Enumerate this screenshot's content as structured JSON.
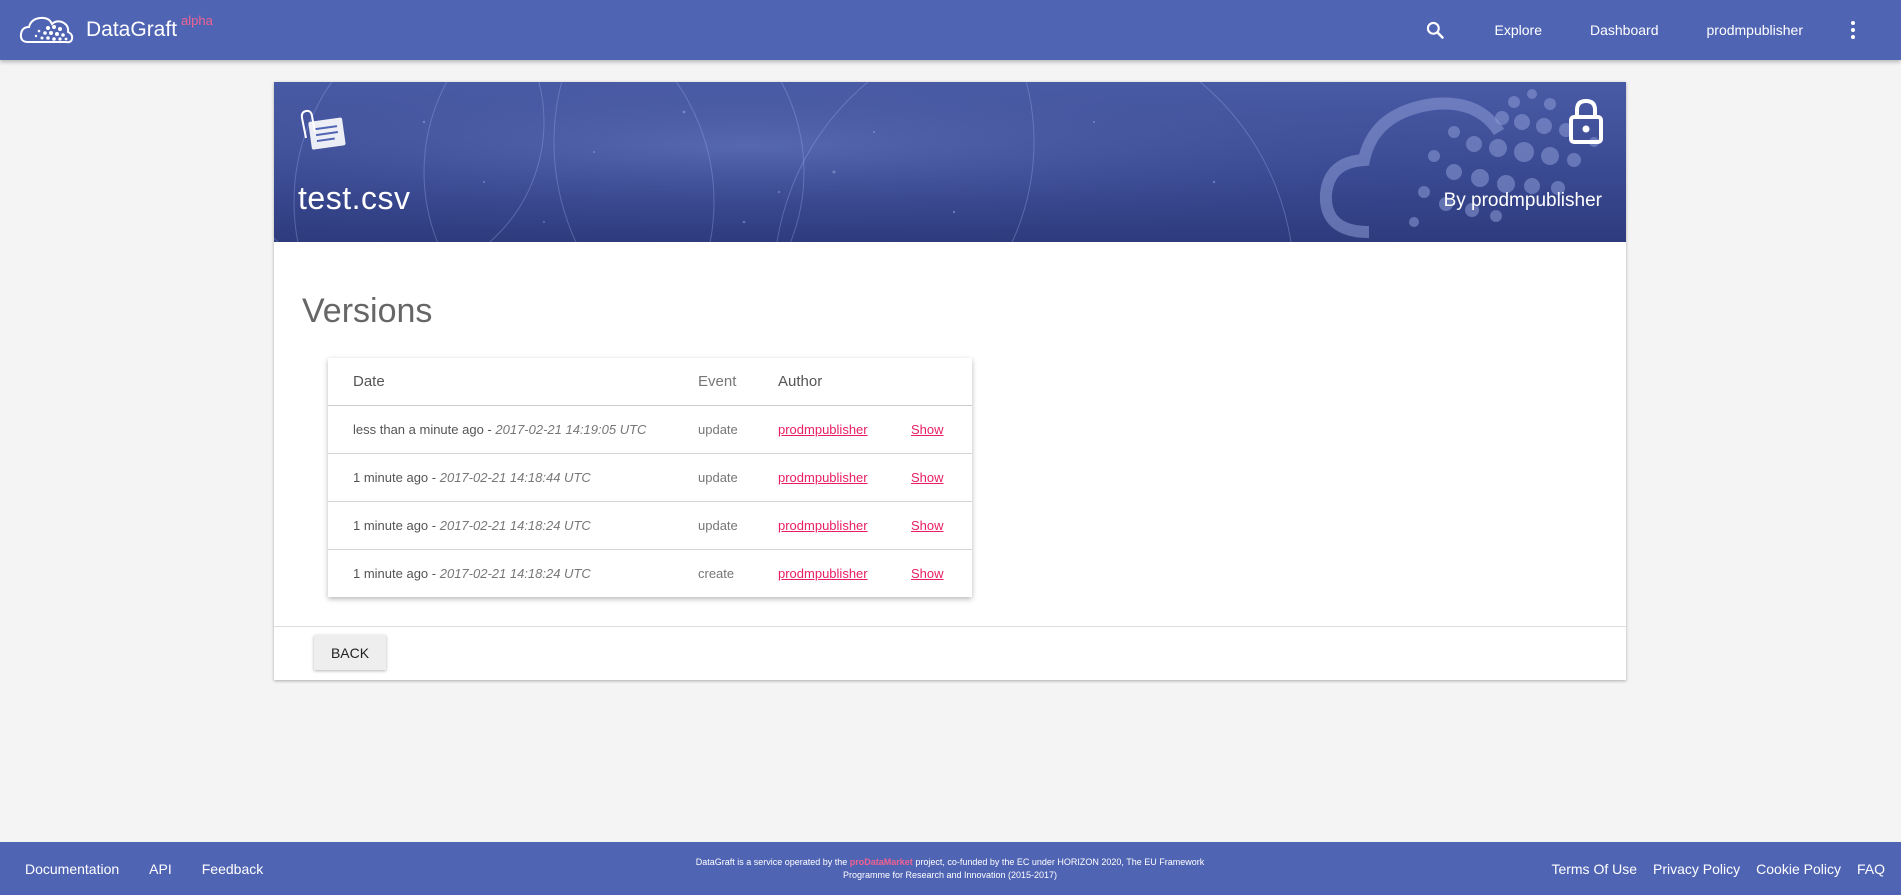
{
  "nav": {
    "brand": "DataGraft",
    "brand_tag": "alpha",
    "links": [
      "Explore",
      "Dashboard",
      "prodmpublisher"
    ]
  },
  "banner": {
    "title": "test.csv",
    "by": "By prodmpublisher"
  },
  "versions": {
    "title": "Versions",
    "columns": [
      "Date",
      "Event",
      "Author",
      ""
    ],
    "rows": [
      {
        "relative": "less than a minute ago",
        "timestamp": "2017-02-21 14:19:05 UTC",
        "event": "update",
        "author": "prodmpublisher",
        "action": "Show"
      },
      {
        "relative": "1 minute ago",
        "timestamp": "2017-02-21 14:18:44 UTC",
        "event": "update",
        "author": "prodmpublisher",
        "action": "Show"
      },
      {
        "relative": "1 minute ago",
        "timestamp": "2017-02-21 14:18:24 UTC",
        "event": "update",
        "author": "prodmpublisher",
        "action": "Show"
      },
      {
        "relative": "1 minute ago",
        "timestamp": "2017-02-21 14:18:24 UTC",
        "event": "create",
        "author": "prodmpublisher",
        "action": "Show"
      }
    ],
    "separator": " - "
  },
  "back_label": "BACK",
  "footer": {
    "left_links": [
      "Documentation",
      "API",
      "Feedback"
    ],
    "center_prefix": "DataGraft is a service operated by the ",
    "center_brand": "proDataMarket",
    "center_suffix": " project, co-funded by the EC under HORIZON 2020, The EU Framework Programme for Research and Innovation (2015-2017)",
    "right_links": [
      "Terms Of Use",
      "Privacy Policy",
      "Cookie Policy",
      "FAQ"
    ]
  },
  "colors": {
    "primary": "#5064b4",
    "accent": "#e91e63",
    "alpha": "#f06292"
  },
  "icons": [
    "cloud-logo-icon",
    "search-icon",
    "more-vert-icon",
    "file-clip-icon",
    "lock-icon"
  ]
}
